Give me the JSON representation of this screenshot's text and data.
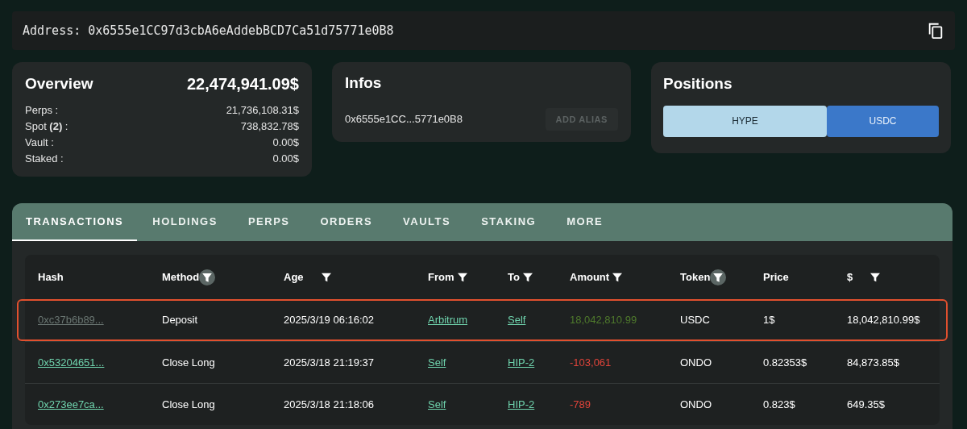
{
  "address": {
    "label": "Address:",
    "value": "0x6555e1CC97d3cbA6eAddebBCD7Ca51d75771e0B8"
  },
  "overview": {
    "title": "Overview",
    "total": "22,474,941.09$",
    "rows": [
      {
        "label": "Perps :",
        "value": "21,736,108.31$"
      },
      {
        "label": "Spot **(2)** :",
        "value": "738,832.78$"
      },
      {
        "label": "Vault :",
        "value": "0.00$"
      },
      {
        "label": "Staked :",
        "value": "0.00$"
      }
    ]
  },
  "infos": {
    "title": "Infos",
    "address": "0x6555e1CC...5771e0B8",
    "button": {
      "label": "ADD ALIAS",
      "disabled": true
    }
  },
  "positions": {
    "title": "Positions",
    "options": [
      {
        "label": "HYPE",
        "selected": true
      },
      {
        "label": "USDC",
        "selected": false
      }
    ]
  },
  "tabs": [
    {
      "label": "TRANSACTIONS",
      "selected": true
    },
    {
      "label": "HOLDINGS",
      "selected": false
    },
    {
      "label": "PERPS",
      "selected": false
    },
    {
      "label": "ORDERS",
      "selected": false
    },
    {
      "label": "VAULTS",
      "selected": false
    },
    {
      "label": "STAKING",
      "selected": false
    },
    {
      "label": "MORE",
      "selected": false
    }
  ],
  "table": {
    "columns": [
      {
        "label": "Hash",
        "kind": "plain"
      },
      {
        "label": "Method",
        "kind": "active"
      },
      {
        "label": "Age",
        "kind": "spaced"
      },
      {
        "label": "From",
        "kind": "filter"
      },
      {
        "label": "To",
        "kind": "filter"
      },
      {
        "label": "Amount",
        "kind": "filter"
      },
      {
        "label": "Token",
        "kind": "active"
      },
      {
        "label": "Price",
        "kind": "plain"
      },
      {
        "label": "$",
        "kind": "spaced"
      }
    ],
    "rows": [
      {
        "highlighted": true,
        "visited": true,
        "hash": "0xc37b6b89...",
        "method": "Deposit",
        "age": "2025/3/19 06:16:02",
        "from": "Arbitrum",
        "to": "Self",
        "amount": {
          "text": "18,042,810.99",
          "kind": "positive"
        },
        "token": "USDC",
        "price": "1$",
        "usd": "18,042,810.99$"
      },
      {
        "highlighted": false,
        "visited": false,
        "hash": "0x53204651...",
        "method": "Close Long",
        "age": "2025/3/18 21:19:37",
        "from": "Self",
        "to": "HIP-2",
        "amount": {
          "text": "-103,061",
          "kind": "negative"
        },
        "token": "ONDO",
        "price": "0.82353$",
        "usd": "84,873.85$"
      },
      {
        "highlighted": false,
        "visited": false,
        "hash": "0x273ee7ca...",
        "method": "Close Long",
        "age": "2025/3/18 21:18:06",
        "from": "Self",
        "to": "HIP-2",
        "amount": {
          "text": "-789",
          "kind": "negative"
        },
        "token": "ONDO",
        "price": "0.823$",
        "usd": "649.35$"
      }
    ]
  }
}
